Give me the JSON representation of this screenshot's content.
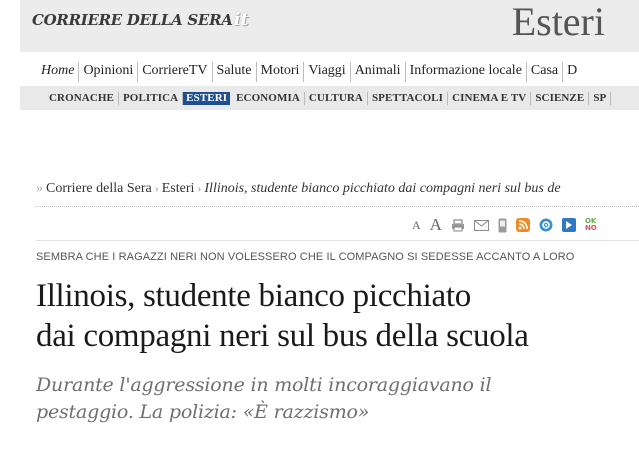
{
  "header": {
    "logo_text": "Corriere della Sera",
    "logo_suffix": "it",
    "section_title": "Esteri"
  },
  "nav_primary": [
    {
      "label": "Home",
      "active": true
    },
    {
      "label": "Opinioni"
    },
    {
      "label": "CorriereTV"
    },
    {
      "label": "Salute"
    },
    {
      "label": "Motori"
    },
    {
      "label": "Viaggi"
    },
    {
      "label": "Animali"
    },
    {
      "label": "Informazione locale"
    },
    {
      "label": "Casa"
    },
    {
      "label": "D"
    }
  ],
  "nav_secondary": [
    {
      "label": "CRONACHE"
    },
    {
      "label": "POLITICA"
    },
    {
      "label": "ESTERI",
      "active": true
    },
    {
      "label": "ECONOMIA"
    },
    {
      "label": "CULTURA"
    },
    {
      "label": "SPETTACOLI"
    },
    {
      "label": "CINEMA E TV"
    },
    {
      "label": "SCIENZE"
    },
    {
      "label": "SP"
    }
  ],
  "breadcrumb": {
    "prefix": "»",
    "items": [
      "Corriere della Sera",
      "Esteri"
    ],
    "separator": "›",
    "current": "Illinois, studente bianco picchiato dai compagni neri sul bus de"
  },
  "tools": {
    "font_small": "A",
    "font_large": "A",
    "icons": [
      "print-icon",
      "email-icon",
      "mobile-icon",
      "rss-icon",
      "share-icon",
      "bookmark-icon",
      "okno-icon"
    ],
    "okno_top": "OK",
    "okno_bottom": "NO"
  },
  "article": {
    "kicker": "SEMBRA CHE I RAGAZZI NERI NON VOLESSERO CHE IL COMPAGNO SI SEDESSE ACCANTO A LORO",
    "headline_line1": "Illinois, studente bianco picchiato",
    "headline_line2": "dai compagni neri sul bus della scuola",
    "subhead_line1": "Durante l'aggressione in molti incoraggiavano il",
    "subhead_line2": "pestaggio. La polizia: «È razzismo»"
  },
  "colors": {
    "header_bg": "#ececec",
    "nav_active_bg": "#1f4f93",
    "rss": "#f08a24",
    "share": "#3b8fd0",
    "ok_green": "#6aa84f",
    "no_red": "#d9534f"
  }
}
